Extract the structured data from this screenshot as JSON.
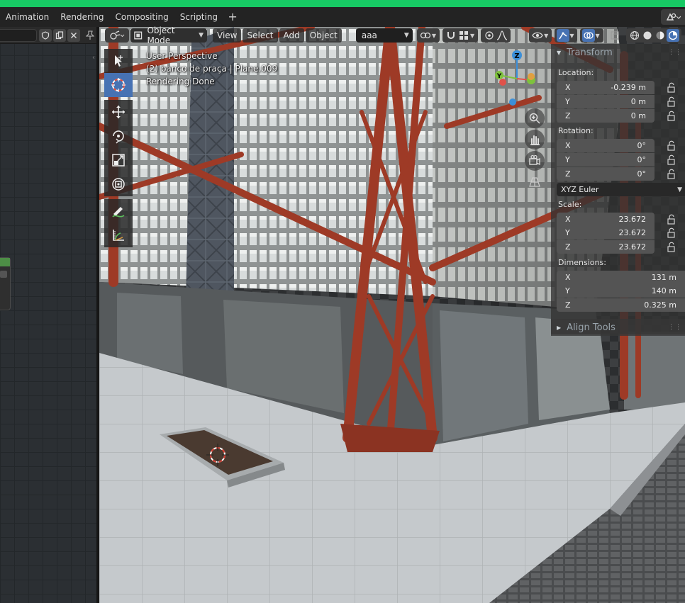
{
  "workspace_tabs": [
    "Animation",
    "Rendering",
    "Compositing",
    "Scripting"
  ],
  "add_workspace_label": "+",
  "viewport_header": {
    "mode": "Object Mode",
    "menus": [
      "View",
      "Select",
      "Add",
      "Object"
    ],
    "selector_value": "aaa"
  },
  "viewport_info": {
    "perspective": "User Perspective",
    "object": "(2) banco de praça | Plane.009",
    "status": "Rendering Done"
  },
  "gizmo_axes": {
    "z": "Z",
    "y": "Y"
  },
  "transform_panel": {
    "title": "Transform",
    "location_label": "Location:",
    "location": [
      {
        "axis": "X",
        "value": "-0.239 m"
      },
      {
        "axis": "Y",
        "value": "0 m"
      },
      {
        "axis": "Z",
        "value": "0 m"
      }
    ],
    "rotation_label": "Rotation:",
    "rotation": [
      {
        "axis": "X",
        "value": "0°"
      },
      {
        "axis": "Y",
        "value": "0°"
      },
      {
        "axis": "Z",
        "value": "0°"
      }
    ],
    "rotation_mode": "XYZ Euler",
    "scale_label": "Scale:",
    "scale": [
      {
        "axis": "X",
        "value": "23.672"
      },
      {
        "axis": "Y",
        "value": "23.672"
      },
      {
        "axis": "Z",
        "value": "23.672"
      }
    ],
    "dimensions_label": "Dimensions:",
    "dimensions": [
      {
        "axis": "X",
        "value": "131 m"
      },
      {
        "axis": "Y",
        "value": "140 m"
      },
      {
        "axis": "Z",
        "value": "0.325 m"
      }
    ]
  },
  "align_tools_panel": {
    "title": "Align Tools"
  },
  "colors": {
    "accent_top": "#17c964",
    "active_blue": "#4772b3",
    "rust": "#9e3a26",
    "gizmo_x": "#e0524a",
    "gizmo_y": "#7ec23c",
    "gizmo_z": "#3b8fd8"
  },
  "toolbar_icons": [
    "select-box-icon",
    "cursor-icon",
    "move-icon",
    "rotate-icon",
    "scale-icon",
    "transform-icon",
    "annotate-icon",
    "measure-icon"
  ]
}
